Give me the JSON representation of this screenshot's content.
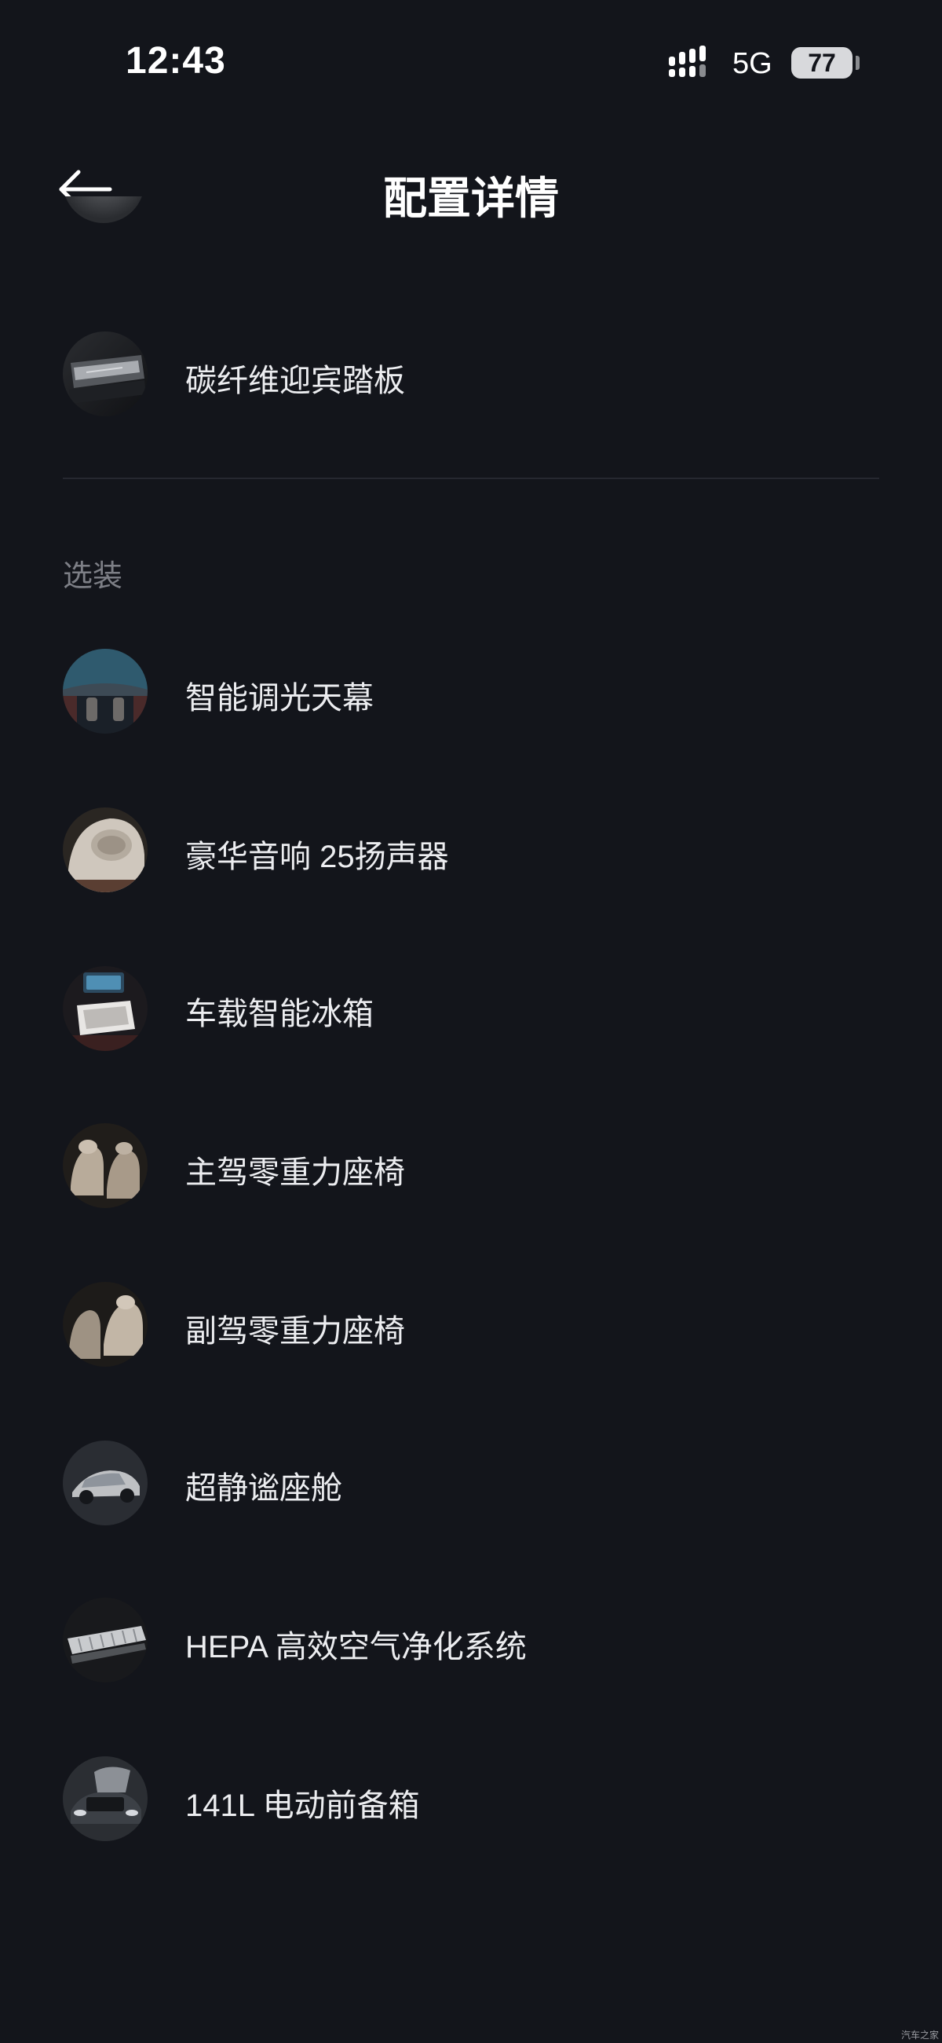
{
  "status_bar": {
    "time": "12:43",
    "network": "5G",
    "battery_level": "77"
  },
  "header": {
    "back_icon": "arrow-left-icon",
    "title": "配置详情"
  },
  "standard_items": [
    {
      "label": "碳纤维迎宾踏板",
      "icon": "carbon-sill-plate-thumbnail"
    }
  ],
  "optional_section": {
    "title": "选装",
    "items": [
      {
        "label": "智能调光天幕",
        "icon": "smart-dimming-roof-thumbnail"
      },
      {
        "label": "豪华音响 25扬声器",
        "icon": "premium-speaker-thumbnail"
      },
      {
        "label": "车载智能冰箱",
        "icon": "car-fridge-thumbnail"
      },
      {
        "label": "主驾零重力座椅",
        "icon": "driver-seat-thumbnail"
      },
      {
        "label": "副驾零重力座椅",
        "icon": "passenger-seat-thumbnail"
      },
      {
        "label": "超静谧座舱",
        "icon": "quiet-cabin-thumbnail"
      },
      {
        "label": "HEPA 高效空气净化系统",
        "icon": "hepa-filter-thumbnail"
      },
      {
        "label": "141L 电动前备箱",
        "icon": "front-trunk-thumbnail"
      }
    ]
  },
  "watermark": "汽车之家"
}
